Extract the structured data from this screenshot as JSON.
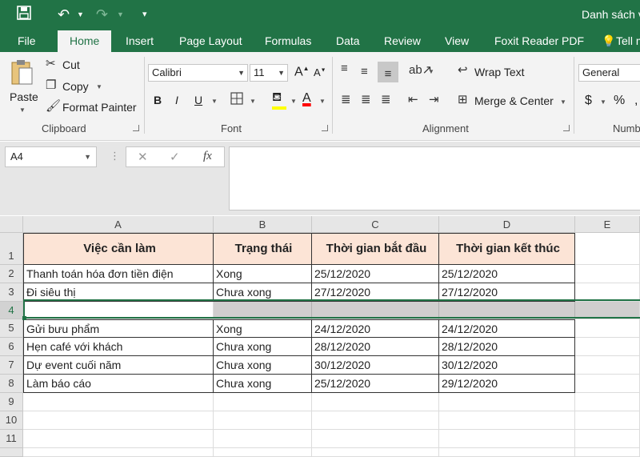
{
  "window": {
    "title": "Danh sách v"
  },
  "tabs": [
    {
      "label": "File"
    },
    {
      "label": "Home"
    },
    {
      "label": "Insert"
    },
    {
      "label": "Page Layout"
    },
    {
      "label": "Formulas"
    },
    {
      "label": "Data"
    },
    {
      "label": "Review"
    },
    {
      "label": "View"
    },
    {
      "label": "Foxit Reader PDF"
    },
    {
      "label": "Tell m"
    }
  ],
  "ribbon": {
    "clipboard": {
      "label": "Clipboard",
      "paste": "Paste",
      "cut": "Cut",
      "copy": "Copy",
      "format_painter": "Format Painter"
    },
    "font": {
      "label": "Font",
      "font_name": "Calibri",
      "font_size": "11",
      "bold": "B",
      "italic": "I",
      "underline": "U",
      "grow": "A",
      "shrink": "A",
      "font_color_letter": "A"
    },
    "alignment": {
      "label": "Alignment",
      "wrap_text": "Wrap Text",
      "merge_center": "Merge & Center"
    },
    "number": {
      "label": "Numb",
      "format": "General",
      "currency": "$",
      "percent": "%"
    }
  },
  "formula_bar": {
    "name_box": "A4",
    "cancel": "✕",
    "enter": "✓",
    "fx": "fx",
    "value": ""
  },
  "sheet": {
    "columns": [
      "A",
      "B",
      "C",
      "D",
      "E"
    ],
    "rows": [
      "1",
      "2",
      "3",
      "4",
      "5",
      "6",
      "7",
      "8",
      "9",
      "10",
      "11"
    ],
    "header": [
      "Việc cần làm",
      "Trạng thái",
      "Thời gian bắt đầu",
      "Thời gian kết thúc"
    ],
    "data": [
      [
        "Thanh toán hóa đơn tiền điện",
        "Xong",
        "25/12/2020",
        "25/12/2020"
      ],
      [
        "Đi siêu thị",
        "Chưa xong",
        "27/12/2020",
        "27/12/2020"
      ],
      [
        "",
        "",
        "",
        ""
      ],
      [
        "Gửi bưu phẩm",
        "Xong",
        "24/12/2020",
        "24/12/2020"
      ],
      [
        "Hẹn café với khách",
        "Chưa xong",
        "28/12/2020",
        "28/12/2020"
      ],
      [
        "Dự event cuối năm",
        "Chưa xong",
        "30/12/2020",
        "30/12/2020"
      ],
      [
        "Làm báo cáo",
        "Chưa xong",
        "25/12/2020",
        "29/12/2020"
      ]
    ]
  },
  "colors": {
    "accent": "#217346",
    "header_fill": "#fce4d6",
    "inserted_row_fill": "#d0cece"
  }
}
